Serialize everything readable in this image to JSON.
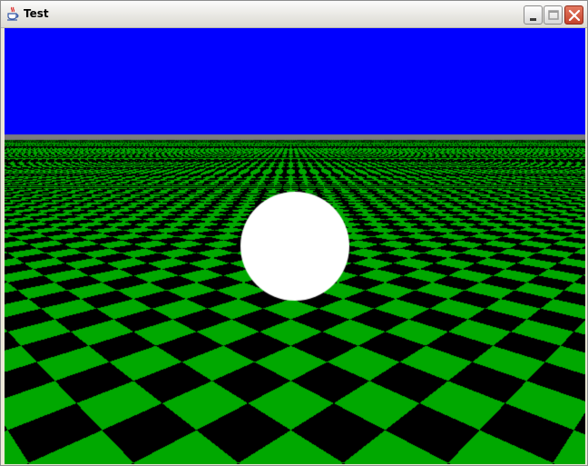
{
  "window": {
    "title": "Test",
    "controls": {
      "minimize_icon": "minimize-icon",
      "maximize_icon": "maximize-icon",
      "close_icon": "close-icon"
    },
    "app_icon": "java-cup-icon"
  },
  "scene": {
    "sky_color": "#0000ff",
    "horizon_color": "#7a7a80",
    "floor_colors": [
      "#00a800",
      "#000000"
    ],
    "ball_color": "#ffffff"
  }
}
